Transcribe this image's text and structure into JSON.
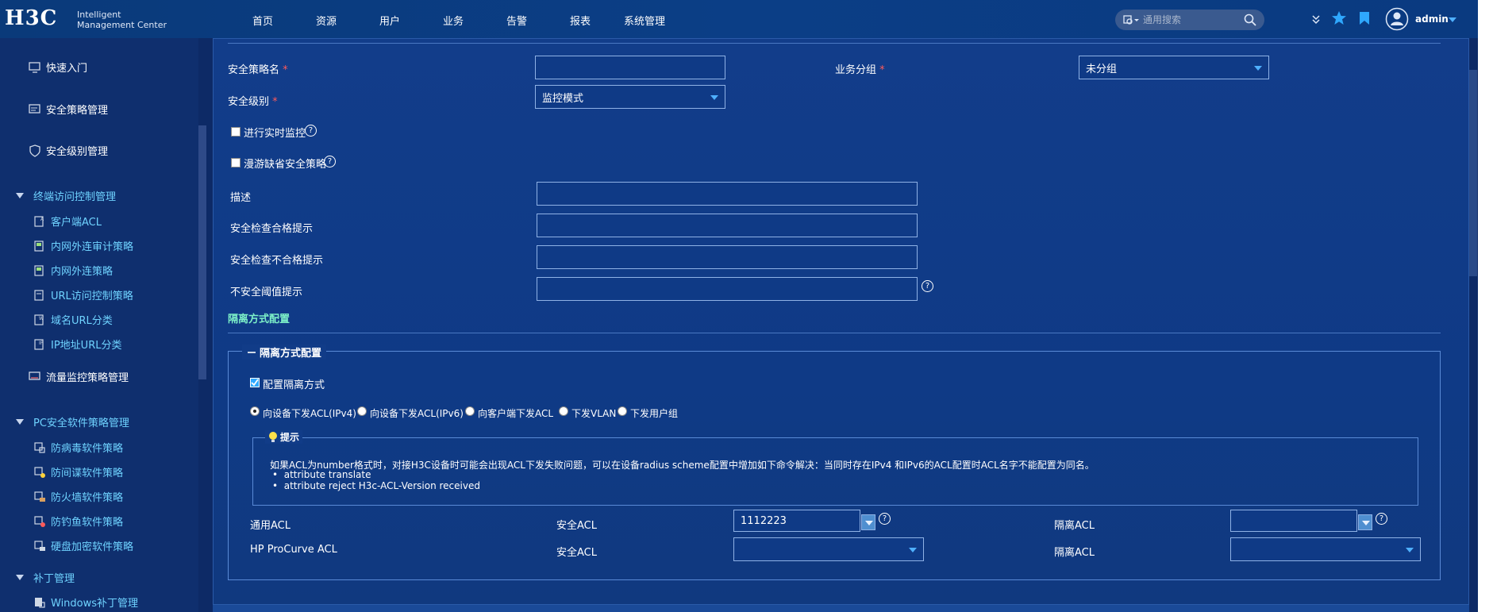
{
  "app": {
    "logo": "H3C",
    "subtitle_line1": "Intelligent",
    "subtitle_line2": "Management Center"
  },
  "nav": {
    "items": [
      "首页",
      "资源",
      "用户",
      "业务",
      "告警",
      "报表",
      "系统管理"
    ]
  },
  "header": {
    "search_placeholder": "通用搜索",
    "user": "admin"
  },
  "sidebar": {
    "quick_start": "快速入门",
    "policy_mgmt": "安全策略管理",
    "level_mgmt": "安全级别管理",
    "terminal_section": "终端访问控制管理",
    "terminal_items": [
      "客户端ACL",
      "内网外连审计策略",
      "内网外连策略",
      "URL访问控制策略",
      "域名URL分类",
      "IP地址URL分类"
    ],
    "traffic_mgmt": "流量监控策略管理",
    "pc_section": "PC安全软件策略管理",
    "pc_items": [
      "防病毒软件策略",
      "防间谍软件策略",
      "防火墙软件策略",
      "防钓鱼软件策略",
      "硬盘加密软件策略"
    ],
    "patch_section": "补丁管理",
    "patch_items": [
      "Windows补丁管理"
    ]
  },
  "form": {
    "policy_name_label": "安全策略名",
    "policy_name_value": "",
    "group_label": "业务分组",
    "group_value": "未分组",
    "level_label": "安全级别",
    "level_value": "监控模式",
    "realtime_label": "进行实时监控",
    "roaming_label": "漫游缺省安全策略",
    "desc_label": "描述",
    "pass_tip_label": "安全检查合格提示",
    "fail_tip_label": "安全检查不合格提示",
    "threshold_label": "不安全阈值提示",
    "required_mark": "*",
    "help_mark": "?"
  },
  "isolation": {
    "section_title": "隔离方式配置",
    "legend": "隔离方式配置",
    "config_label": "配置隔离方式",
    "options": [
      "向设备下发ACL(IPv4)",
      "向设备下发ACL(IPv6)",
      "向客户端下发ACL",
      "下发VLAN",
      "下发用户组"
    ],
    "selected_index": 0,
    "tip_title": "提示",
    "tip_text": "如果ACL为number格式时，对接H3C设备时可能会出现ACL下发失败问题，可以在设备radius scheme配置中增加如下命令解决：当同时存在IPv4 和IPv6的ACL配置时ACL名字不能配置为同名。",
    "tip_bullets": [
      "attribute translate",
      "attribute reject H3c-ACL-Version received"
    ],
    "row1_label": "通用ACL",
    "row2_label": "HP ProCurve ACL",
    "secure_acl_label": "安全ACL",
    "isolate_acl_label": "隔离ACL",
    "row1_secure_value": "1112223",
    "row1_isolate_value": "",
    "row2_secure_value": "",
    "row2_isolate_value": ""
  },
  "colors": {
    "accent": "#4fb0ff",
    "link": "#6fd3ff",
    "required": "#ff5a5a",
    "section_title": "#7df0c8"
  }
}
